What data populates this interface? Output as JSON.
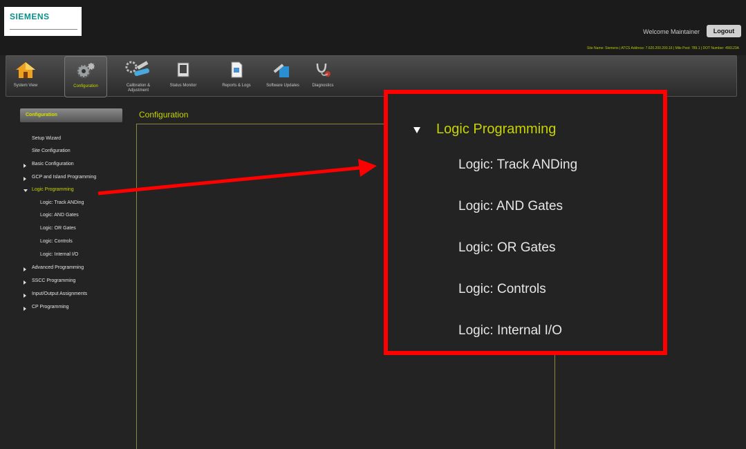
{
  "header": {
    "logo": "SIEMENS",
    "welcome": "Welcome Maintainer",
    "logout_label": "Logout",
    "site_info": "Site Name: Siemens | ATCS Address: 7.620.200.200.16 | Mile Post: 789.1 | DOT Number: 456123A"
  },
  "toolbar": [
    {
      "label": "System View",
      "icon": "house-icon"
    },
    {
      "label": "Configuration",
      "icon": "gears-icon",
      "active": true
    },
    {
      "label": "Calibration & Adjustment",
      "icon": "wrench-gear-icon"
    },
    {
      "label": "Status Monitor",
      "icon": "monitor-icon"
    },
    {
      "label": "Reports & Logs",
      "icon": "document-icon"
    },
    {
      "label": "Software Updates",
      "icon": "install-icon"
    },
    {
      "label": "Diagnostics",
      "icon": "stethoscope-icon"
    }
  ],
  "sidebar": {
    "header": "Configuration",
    "items": [
      {
        "label": "Setup Wizard"
      },
      {
        "label": "Site Configuration"
      },
      {
        "label": "Basic Configuration",
        "expander": "right"
      },
      {
        "label": "GCP and Island Programming",
        "expander": "right"
      },
      {
        "label": "Logic Programming",
        "expander": "down",
        "active": true
      },
      {
        "label": "Logic: Track ANDing"
      },
      {
        "label": "Logic: AND Gates"
      },
      {
        "label": "Logic: OR Gates"
      },
      {
        "label": "Logic: Controls"
      },
      {
        "label": "Logic: Internal I/O"
      },
      {
        "label": "Advanced Programming",
        "expander": "right"
      },
      {
        "label": "SSCC Programming",
        "expander": "right"
      },
      {
        "label": "Input/Output Assignments",
        "expander": "right"
      },
      {
        "label": "CP Programming",
        "expander": "right"
      }
    ]
  },
  "main": {
    "title": "Configuration"
  },
  "callout": {
    "title": "Logic Programming",
    "items": [
      "Logic: Track ANDing",
      "Logic: AND Gates",
      "Logic: OR Gates",
      "Logic: Controls",
      "Logic: Internal I/O"
    ],
    "border_color": "#ff0000"
  },
  "colors": {
    "accent": "#c7d400",
    "annotation": "#ff0000",
    "background": "#232323"
  }
}
